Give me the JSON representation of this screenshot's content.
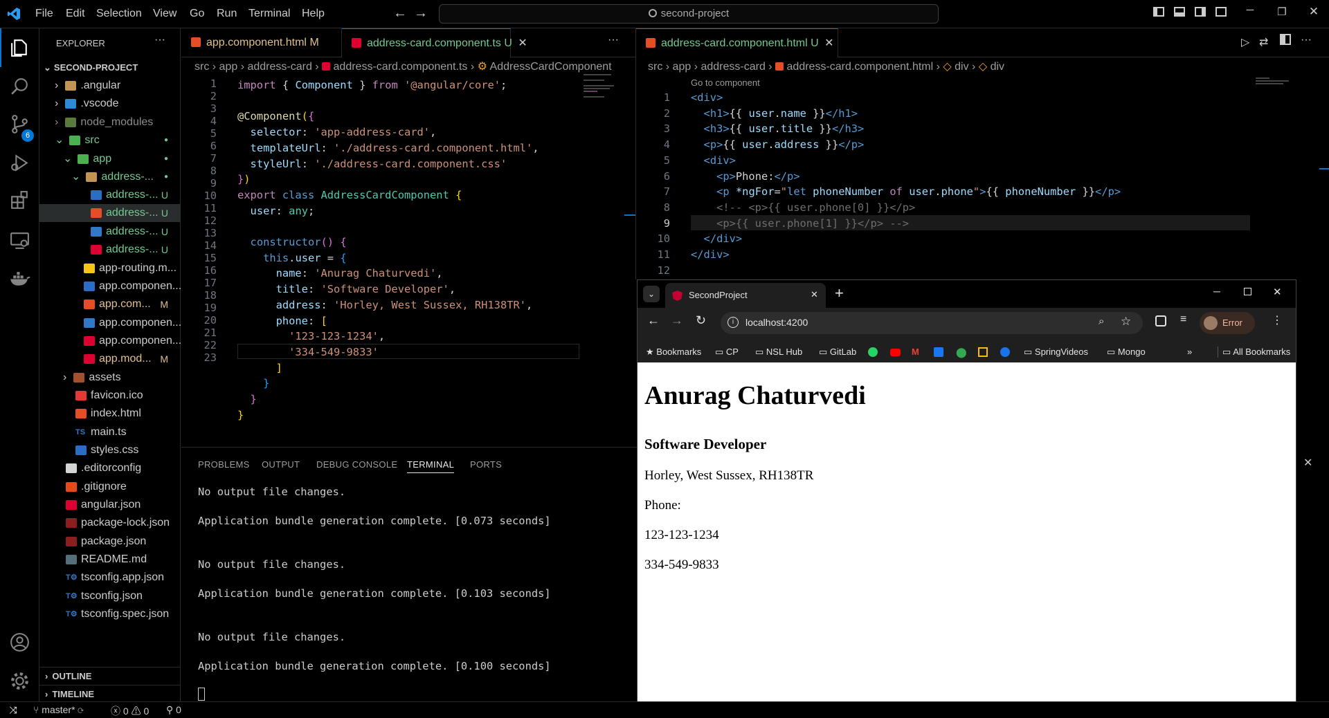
{
  "menu": [
    "File",
    "Edit",
    "Selection",
    "View",
    "Go",
    "Run",
    "Terminal",
    "Help"
  ],
  "search": "second-project",
  "explorer": {
    "title": "EXPLORER",
    "project": "SECOND-PROJECT",
    "items": [
      {
        "label": ".angular",
        "status": ""
      },
      {
        "label": ".vscode",
        "status": ""
      },
      {
        "label": "node_modules",
        "status": ""
      },
      {
        "label": "src",
        "status": "●"
      },
      {
        "label": "app",
        "status": "●"
      },
      {
        "label": "address-...",
        "status": "●"
      },
      {
        "label": "address-...",
        "status": "U"
      },
      {
        "label": "address-...",
        "status": "U"
      },
      {
        "label": "address-...",
        "status": "U"
      },
      {
        "label": "address-...",
        "status": "U"
      },
      {
        "label": "app-routing.m...",
        "status": ""
      },
      {
        "label": "app.componen...",
        "status": ""
      },
      {
        "label": "app.com...",
        "status": "M"
      },
      {
        "label": "app.componen...",
        "status": ""
      },
      {
        "label": "app.componen...",
        "status": ""
      },
      {
        "label": "app.mod...",
        "status": "M"
      },
      {
        "label": "assets",
        "status": ""
      },
      {
        "label": "favicon.ico",
        "status": ""
      },
      {
        "label": "index.html",
        "status": ""
      },
      {
        "label": "main.ts",
        "status": ""
      },
      {
        "label": "styles.css",
        "status": ""
      },
      {
        "label": ".editorconfig",
        "status": ""
      },
      {
        "label": ".gitignore",
        "status": ""
      },
      {
        "label": "angular.json",
        "status": ""
      },
      {
        "label": "package-lock.json",
        "status": ""
      },
      {
        "label": "package.json",
        "status": ""
      },
      {
        "label": "README.md",
        "status": ""
      },
      {
        "label": "tsconfig.app.json",
        "status": ""
      },
      {
        "label": "tsconfig.json",
        "status": ""
      },
      {
        "label": "tsconfig.spec.json",
        "status": ""
      }
    ],
    "outline": "OUTLINE",
    "timeline": "TIMELINE"
  },
  "left_editor": {
    "tabs": [
      {
        "label": "app.component.html",
        "status": "M"
      },
      {
        "label": "address-card.component.ts",
        "status": "U"
      }
    ],
    "breadcrumb": [
      "src",
      "app",
      "address-card",
      "address-card.component.ts",
      "AddressCardComponent"
    ]
  },
  "right_editor": {
    "tab": {
      "label": "address-card.component.html",
      "status": "U"
    },
    "breadcrumb": [
      "src",
      "app",
      "address-card",
      "address-card.component.html",
      "div",
      "div"
    ],
    "hint": "Go to component"
  },
  "panel": {
    "tabs": [
      "PROBLEMS",
      "OUTPUT",
      "DEBUG CONSOLE",
      "TERMINAL",
      "PORTS"
    ],
    "lines": [
      "No output file changes.",
      "Application bundle generation complete. [0.073 seconds]",
      "No output file changes.",
      "Application bundle generation complete. [0.103 seconds]",
      "No output file changes.",
      "Application bundle generation complete. [0.100 seconds]"
    ]
  },
  "browser": {
    "tab_title": "SecondProject",
    "url": "localhost:4200",
    "profile": "Error",
    "bookmarks": [
      "Bookmarks",
      "CP",
      "NSL Hub",
      "GitLab",
      "SpringVideos",
      "Mongo",
      "All Bookmarks"
    ],
    "page": {
      "name": "Anurag Chaturvedi",
      "title": "Software Developer",
      "address": "Horley, West Sussex, RH138TR",
      "phone_label": "Phone:",
      "phones": [
        "123-123-1234",
        "334-549-9833"
      ]
    }
  },
  "status": {
    "branch": "master*",
    "errors": "0",
    "warnings": "0",
    "ports": "0",
    "source_control_badge": "6"
  }
}
